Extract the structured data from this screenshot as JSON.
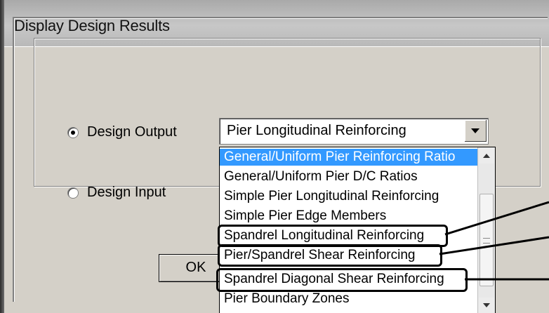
{
  "window": {
    "title": "Display Design Results"
  },
  "design_output": {
    "label": "Design Output",
    "selected": true
  },
  "design_input": {
    "label": "Design Input",
    "selected": false
  },
  "combo": {
    "value": "Pier Longitudinal Reinforcing",
    "arrow_icon": "chevron-down-icon"
  },
  "ok_button": {
    "label": "OK"
  },
  "dropdown": {
    "items": [
      "General/Uniform Pier Reinforcing Ratio",
      "General/Uniform Pier D/C Ratios",
      "Simple Pier Longitudinal Reinforcing",
      "Simple Pier Edge Members",
      "Spandrel Longitudinal Reinforcing",
      "Pier/Spandrel Shear Reinforcing",
      "Spandrel Diagonal Shear Reinforcing",
      "Pier Boundary Zones"
    ],
    "selected_index": 0,
    "highlighted_items": [
      4,
      5,
      6
    ]
  },
  "colors": {
    "selection": "#3399ff",
    "dialog_bg": "#d4d0c8"
  }
}
